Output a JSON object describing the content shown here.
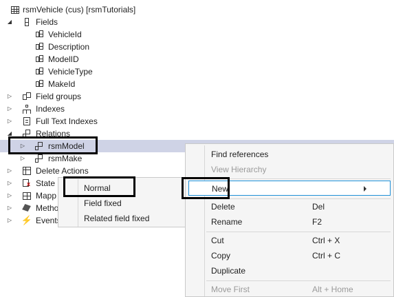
{
  "tree": {
    "root": {
      "label": "rsmVehicle (cus) [rsmTutorials]",
      "icon": "table-icon"
    },
    "fields": {
      "label": "Fields",
      "icon": "fields-icon",
      "items": [
        "VehicleId",
        "Description",
        "ModelID",
        "VehicleType",
        "MakeId"
      ]
    },
    "field_groups": {
      "label": "Field groups"
    },
    "indexes": {
      "label": "Indexes"
    },
    "full_text_indexes": {
      "label": "Full Text Indexes"
    },
    "relations": {
      "label": "Relations",
      "items": [
        "rsmModel",
        "rsmMake"
      ]
    },
    "delete_actions": {
      "label": "Delete Actions"
    },
    "state_machines": {
      "label": "State M"
    },
    "mappings": {
      "label": "Mapp"
    },
    "methods": {
      "label": "Metho"
    },
    "events": {
      "label": "Events"
    }
  },
  "submenu": {
    "items": [
      "Normal",
      "Field fixed",
      "Related field fixed"
    ]
  },
  "context_menu": {
    "find_references": "Find references",
    "view_hierarchy": "View Hierarchy",
    "new": "New",
    "delete": "Delete",
    "delete_key": "Del",
    "rename": "Rename",
    "rename_key": "F2",
    "cut": "Cut",
    "cut_key": "Ctrl + X",
    "copy": "Copy",
    "copy_key": "Ctrl + C",
    "duplicate": "Duplicate",
    "move_first": "Move First",
    "move_first_key": "Alt + Home"
  },
  "colors": {
    "selection": "#cfd3e6",
    "menu_background": "#f5f5f5",
    "active_border": "#1e90d8",
    "event_icon": "#d08a00"
  }
}
